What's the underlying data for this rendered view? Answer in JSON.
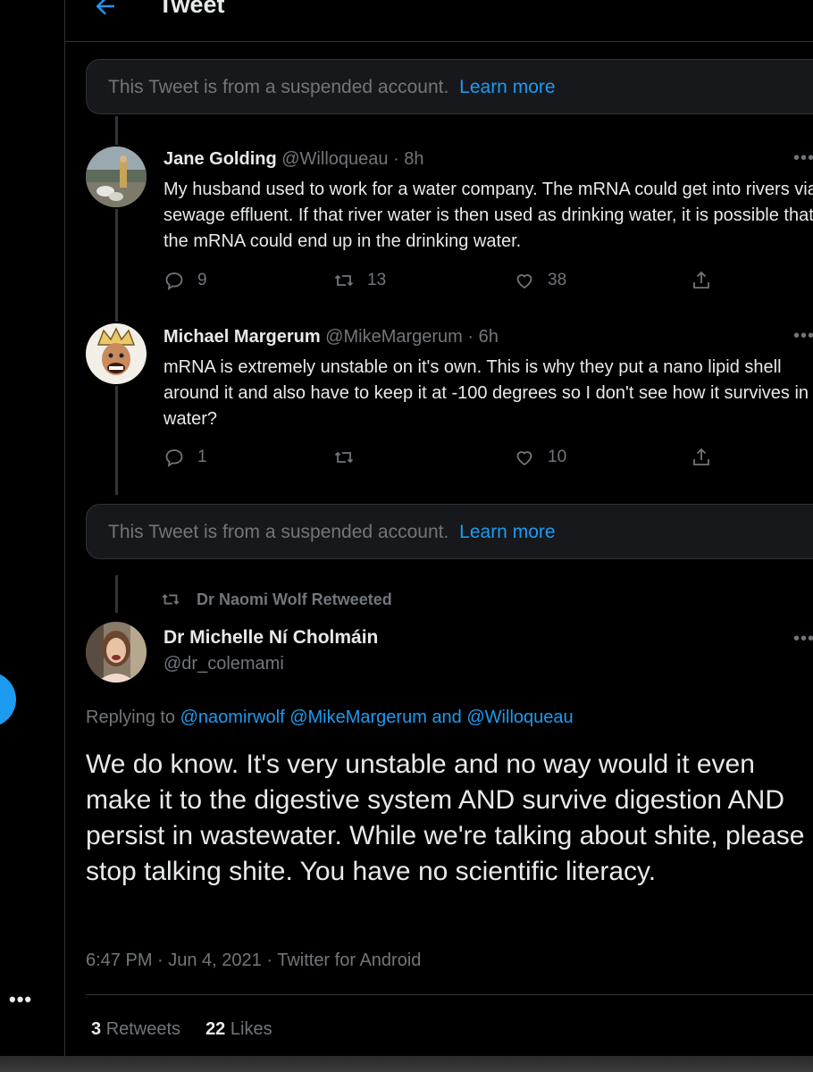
{
  "header": {
    "title": "Tweet"
  },
  "suspended_notice": {
    "text": "This Tweet is from a suspended account.",
    "link": "Learn more"
  },
  "tweets": [
    {
      "name": "Jane Golding",
      "handle": "@Willoqueau",
      "time": "8h",
      "text": "My husband used to work for a water company.  The mRNA could get into rivers via sewage effluent.  If that river water is then used as drinking water, it is possible that the mRNA could end up in the drinking water.",
      "replies": "9",
      "retweets": "13",
      "likes": "38"
    },
    {
      "name": "Michael Margerum",
      "handle": "@MikeMargerum",
      "time": "6h",
      "text": "mRNA is extremely unstable on it's own.  This is why they put a nano lipid shell around it and also have to keep it at -100 degrees so I don't see how it survives in water?",
      "replies": "1",
      "retweets": "",
      "likes": "10"
    }
  ],
  "main_tweet": {
    "retweeted_by": "Dr Naomi Wolf Retweeted",
    "name": "Dr Michelle Ní Cholmáin",
    "handle": "@dr_colemami",
    "replying_prefix": "Replying to",
    "replying_1": "@naomirwolf",
    "replying_2": "@MikeMargerum",
    "replying_and": "and",
    "replying_3": "@Willoqueau",
    "text": "We do know. It's very unstable and no way would it even make it to the digestive system AND survive digestion AND persist in wastewater. While we're talking about shite, please stop talking shite. You have no scientific literacy.",
    "timestamp": "6:47 PM · Jun 4, 2021 · Twitter for Android",
    "retweets_count": "3",
    "retweets_label": "Retweets",
    "likes_count": "22",
    "likes_label": "Likes"
  },
  "sidebar": {
    "more": "•••"
  },
  "colors": {
    "accent": "#1d9bf0",
    "muted": "#71767b",
    "background": "#000000"
  }
}
